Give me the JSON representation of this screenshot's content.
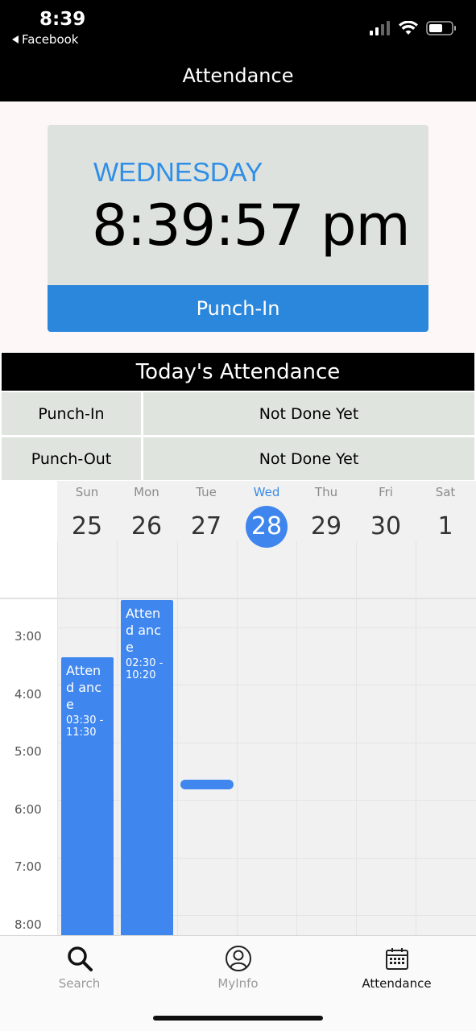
{
  "status_bar": {
    "time": "8:39",
    "back_label": "Facebook"
  },
  "nav": {
    "title": "Attendance"
  },
  "clock_card": {
    "day": "WEDNESDAY",
    "time": "8:39:57 pm",
    "button_label": "Punch-In"
  },
  "today": {
    "header": "Today's Attendance",
    "rows": [
      {
        "label": "Punch-In",
        "value": "Not Done Yet"
      },
      {
        "label": "Punch-Out",
        "value": "Not Done Yet"
      }
    ]
  },
  "calendar": {
    "days": [
      {
        "dow": "Sun",
        "num": "25"
      },
      {
        "dow": "Mon",
        "num": "26"
      },
      {
        "dow": "Tue",
        "num": "27"
      },
      {
        "dow": "Wed",
        "num": "28",
        "active": true
      },
      {
        "dow": "Thu",
        "num": "29"
      },
      {
        "dow": "Fri",
        "num": "30"
      },
      {
        "dow": "Sat",
        "num": "1"
      }
    ],
    "hours": [
      "3:00",
      "4:00",
      "5:00",
      "6:00",
      "7:00",
      "8:00"
    ],
    "events": [
      {
        "title": "Attendance",
        "title_display": "Attend ance",
        "range": "03:30 - 11:30",
        "day": "Sun"
      },
      {
        "title": "Attendance",
        "title_display": "Attend ance",
        "range": "02:30 - 10:20",
        "day": "Mon"
      }
    ]
  },
  "tabbar": {
    "tabs": [
      {
        "label": "Search",
        "icon": "search-icon"
      },
      {
        "label": "MyInfo",
        "icon": "person-icon"
      },
      {
        "label": "Attendance",
        "icon": "calendar-icon",
        "active": true
      }
    ]
  },
  "colors": {
    "accent": "#2b87dc",
    "event": "#3f86ee",
    "day_text": "#2f8ee5",
    "card": "#dde2de"
  }
}
